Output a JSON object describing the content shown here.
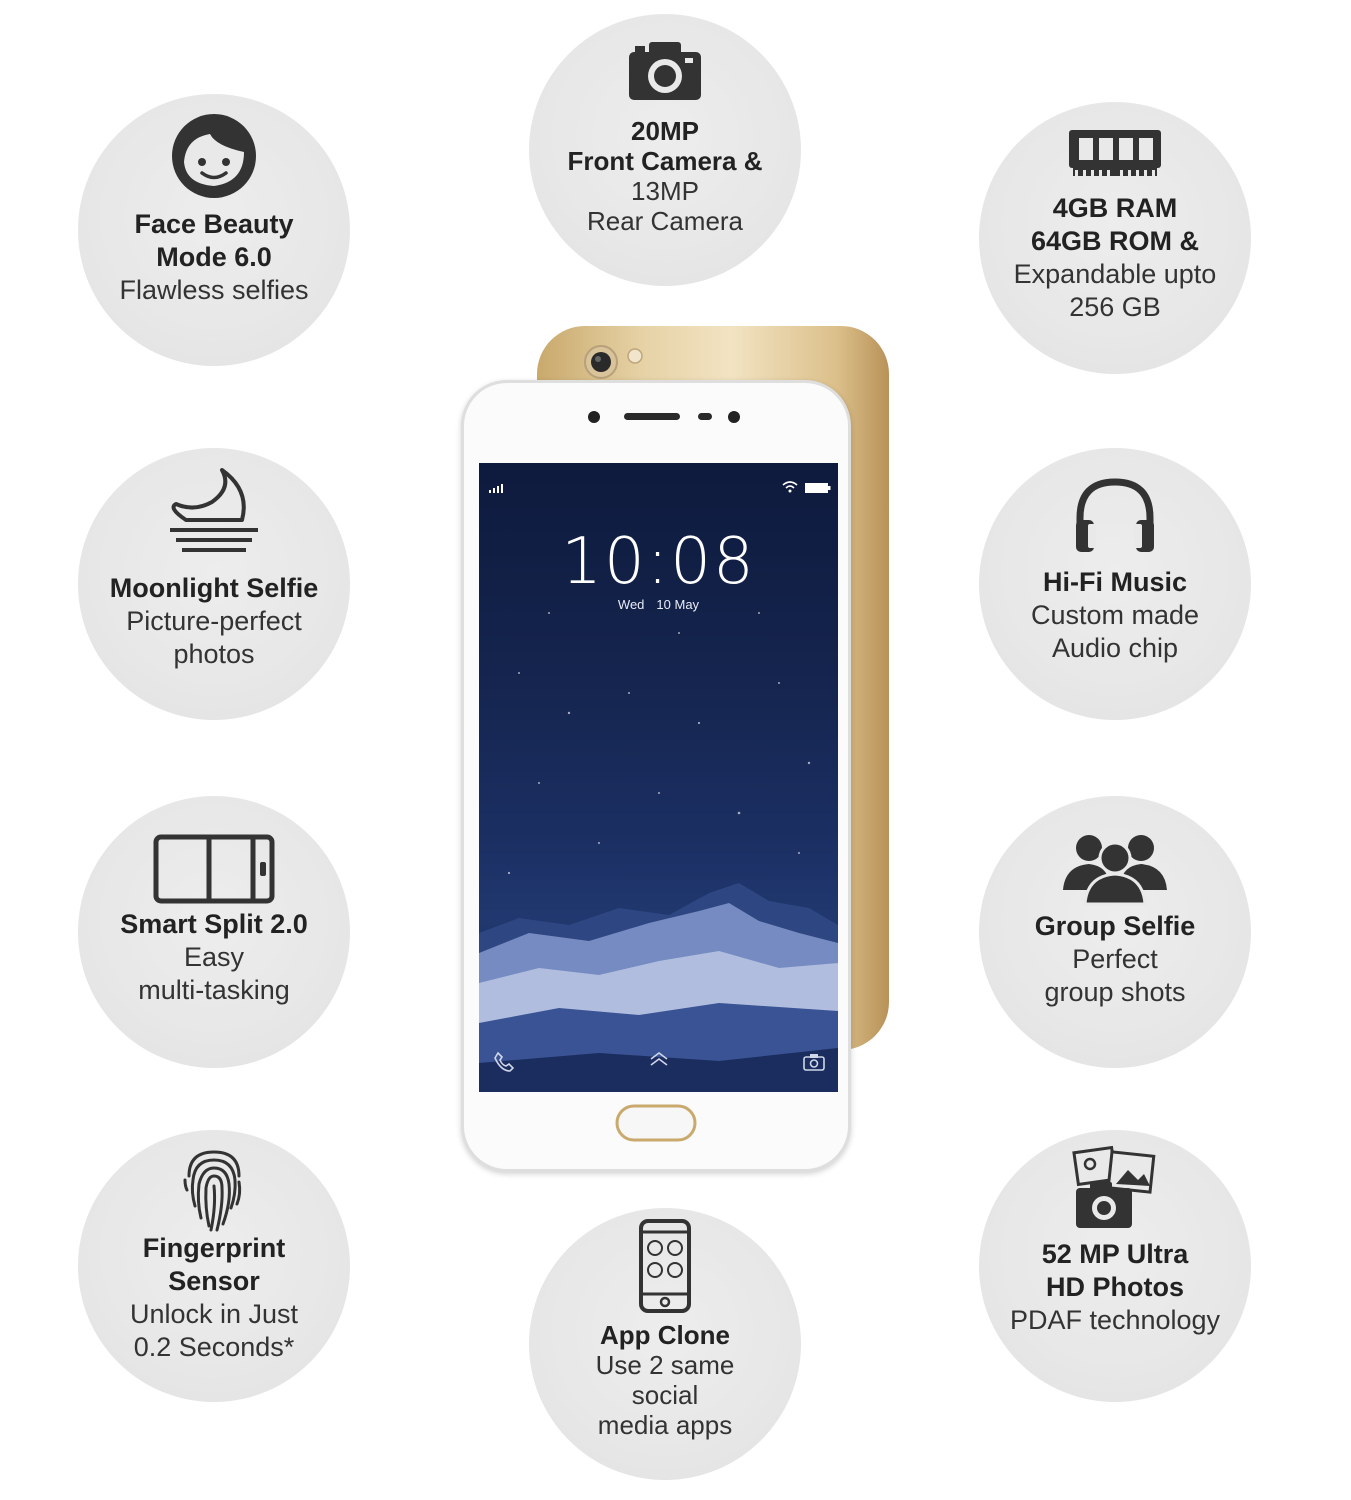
{
  "features": {
    "face_beauty": {
      "title_1": "Face Beauty",
      "title_2": "Mode 6.0",
      "desc_1": "Flawless selfies",
      "icon": "face-icon"
    },
    "camera": {
      "title_1": "20MP",
      "title_2": "Front Camera &",
      "desc_1": "13MP",
      "desc_2": "Rear Camera",
      "icon": "camera-icon"
    },
    "ram": {
      "title_1": "4GB RAM",
      "title_2": "64GB ROM &",
      "desc_1": "Expandable upto",
      "desc_2": "256 GB",
      "icon": "ram-chip-icon"
    },
    "moonlight": {
      "title_1": "Moonlight Selfie",
      "desc_1": "Picture-perfect",
      "desc_2": "photos",
      "icon": "moon-icon"
    },
    "hifi": {
      "title_1": "Hi-Fi Music",
      "desc_1": "Custom made",
      "desc_2": "Audio chip",
      "icon": "headphones-icon"
    },
    "split": {
      "title_1": "Smart Split 2.0",
      "desc_1": "Easy",
      "desc_2": "multi-tasking",
      "icon": "split-screen-icon"
    },
    "group": {
      "title_1": "Group Selfie",
      "desc_1": "Perfect",
      "desc_2": "group shots",
      "icon": "group-icon"
    },
    "fingerprint": {
      "title_1": "Fingerprint",
      "title_2": "Sensor",
      "desc_1": "Unlock in Just",
      "desc_2": "0.2 Seconds*",
      "icon": "fingerprint-icon"
    },
    "app_clone": {
      "title_1": "App Clone",
      "desc_1": "Use 2 same",
      "desc_2": "social",
      "desc_3": "media apps",
      "icon": "app-clone-icon"
    },
    "photos": {
      "title_1": "52 MP Ultra",
      "title_2": "HD Photos",
      "desc_1": "PDAF technology",
      "icon": "photos-icon"
    }
  },
  "phone": {
    "clock": "10:08",
    "day": "Wed",
    "date": "10 May",
    "colors": {
      "body": "#e6d2a6",
      "front": "#fbfbfb",
      "screen": "#15254f"
    }
  }
}
